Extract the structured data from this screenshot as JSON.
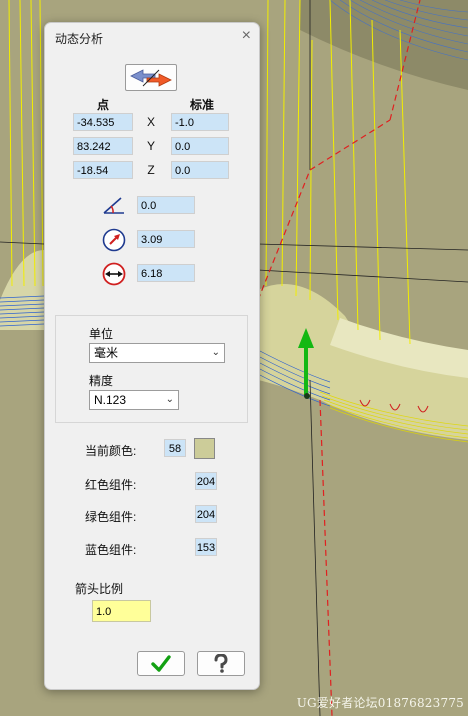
{
  "dialog": {
    "title": "动态分析",
    "close_label": "×",
    "point_header": "点",
    "normal_header": "标准",
    "coords": [
      {
        "axis": "X",
        "point": "-34.535",
        "normal": "-1.0"
      },
      {
        "axis": "Y",
        "point": "83.242",
        "normal": "0.0"
      },
      {
        "axis": "Z",
        "point": "-18.54",
        "normal": "0.0"
      }
    ],
    "angle_value": "0.0",
    "radius_value": "3.09",
    "diameter_value": "6.18",
    "unit_label": "单位",
    "unit_selected": "毫米",
    "precision_label": "精度",
    "precision_selected": "N.123",
    "current_color_label": "当前颜色:",
    "current_color_value": "58",
    "current_color_hex": "#cccc99",
    "red_label": "红色组件:",
    "red_value": "204",
    "green_label": "绿色组件:",
    "green_value": "204",
    "blue_label": "蓝色组件:",
    "blue_value": "153",
    "arrow_scale_label": "箭头比例",
    "arrow_scale_value": "1.0",
    "ok_icon": "check-icon",
    "help_icon": "help-icon"
  },
  "watermark": "UG爱好者论坛01876823775"
}
